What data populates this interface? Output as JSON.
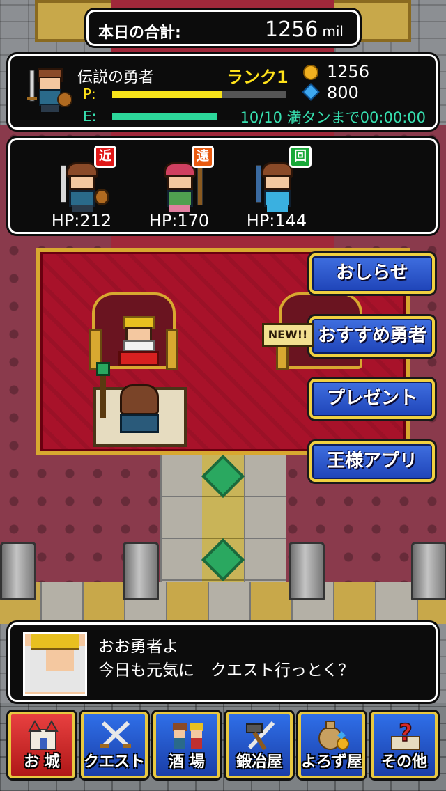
{
  "total": {
    "label": "本日の合計:",
    "value": "1256",
    "unit": "mil"
  },
  "status": {
    "hero_name": "伝説の勇者",
    "rank": "ランク1",
    "p_label": "P:",
    "p_fill": 0.63,
    "e_label": "E:",
    "e_fill": 1.0,
    "stamina": "10/10 満タンまで00:00:00",
    "gold": "1256",
    "gems": "800",
    "colors": {
      "p_bar": "#f6e21a",
      "e_bar": "#2cd79a",
      "rank": "#ffe21a"
    }
  },
  "party": [
    {
      "role": "近",
      "hp": "HP:212",
      "role_color": "#e01818"
    },
    {
      "role": "遠",
      "hp": "HP:170",
      "role_color": "#e85a10"
    },
    {
      "role": "回",
      "hp": "HP:144",
      "role_color": "#18a838"
    }
  ],
  "side_menu": {
    "news": "おしらせ",
    "recommended": "おすすめ勇者",
    "present": "プレゼント",
    "king_app": "王様アプリ",
    "new_badge": "NEW!!"
  },
  "message": {
    "line1": "おお勇者よ",
    "line2": "今日も元気に　クエスト行っとく？"
  },
  "nav": [
    {
      "label": "お 城",
      "icon": "castle-icon",
      "active": true
    },
    {
      "label": "クエスト",
      "icon": "crossed-swords-icon",
      "active": false
    },
    {
      "label": "酒 場",
      "icon": "tavern-heroes-icon",
      "active": false
    },
    {
      "label": "鍛冶屋",
      "icon": "hammer-sword-icon",
      "active": false
    },
    {
      "label": "よろず屋",
      "icon": "item-bag-icon",
      "active": false
    },
    {
      "label": "その他",
      "icon": "question-scroll-icon",
      "active": false
    }
  ]
}
